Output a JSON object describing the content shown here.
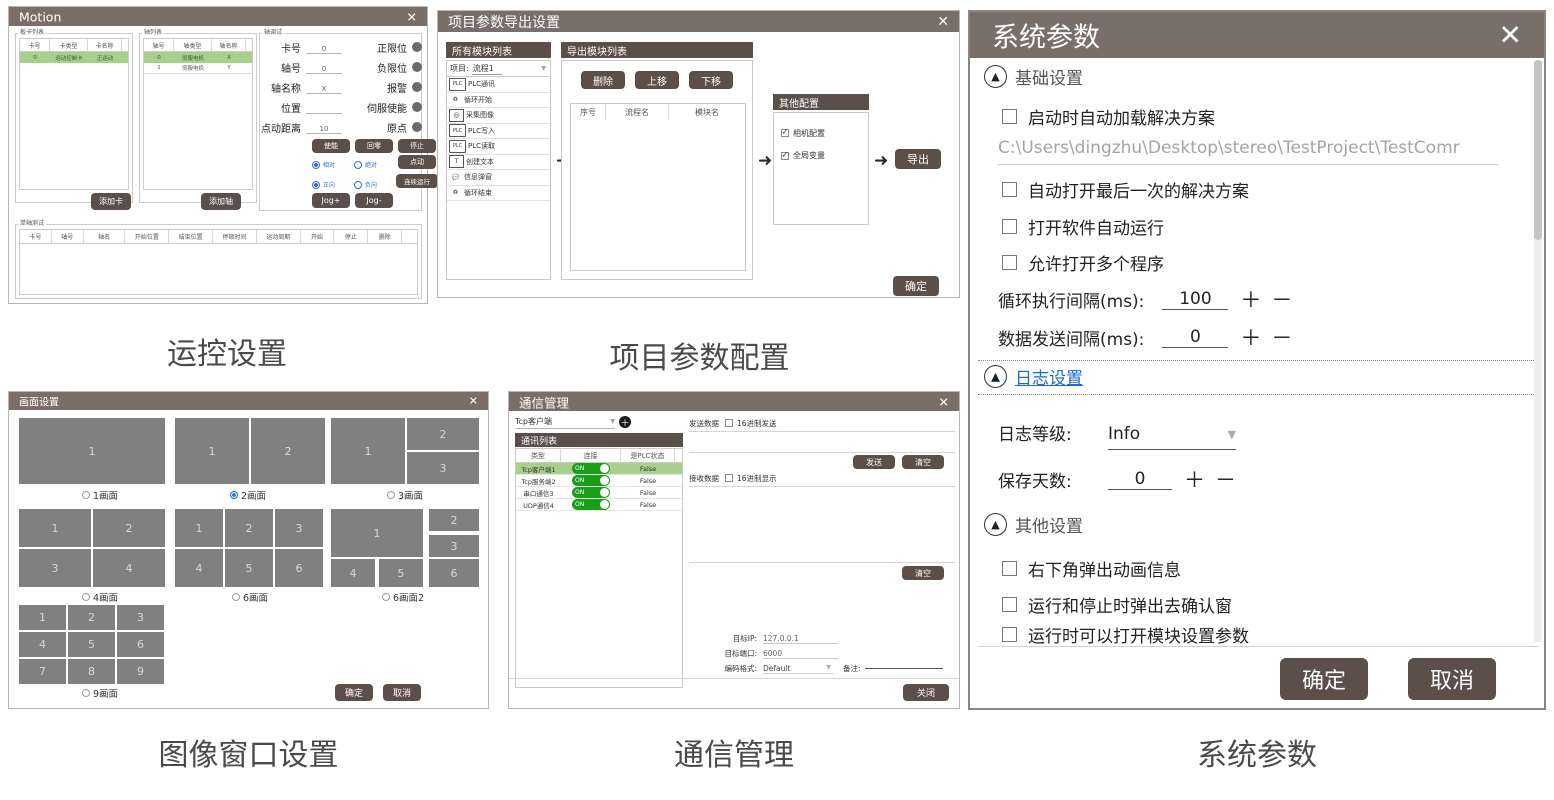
{
  "motion": {
    "title": "Motion",
    "close": "✕",
    "card_group_label": "板卡列表",
    "card_columns": [
      "卡号",
      "卡类型",
      "卡名称"
    ],
    "card_rows": [
      [
        "0",
        "运动控制卡",
        "正运动"
      ]
    ],
    "axis_group_label": "轴列表",
    "axis_columns": [
      "轴号",
      "轴类型",
      "轴名称"
    ],
    "axis_rows": [
      [
        "0",
        "伺服电机",
        "X"
      ],
      [
        "1",
        "伺服电机",
        "Y"
      ]
    ],
    "add_card_button": "添加卡",
    "add_axis_button": "添加轴",
    "debug_group_label": "轴调试",
    "fields": [
      {
        "label": "卡号",
        "value": "0"
      },
      {
        "label": "轴号",
        "value": "0"
      },
      {
        "label": "轴名称",
        "value": "X"
      },
      {
        "label": "位置",
        "value": ""
      },
      {
        "label": "点动距离",
        "value": "10"
      }
    ],
    "status": [
      {
        "label": "正限位"
      },
      {
        "label": "负限位"
      },
      {
        "label": "报警"
      },
      {
        "label": "伺服使能"
      },
      {
        "label": "原点"
      }
    ],
    "buttons": {
      "enable": "使能",
      "home": "回零",
      "stop": "停止",
      "jog_once": "点动",
      "continuous": "连续运行",
      "jog_plus": "Jog+",
      "jog_minus": "Jog-"
    },
    "radios": {
      "relative": "相对",
      "absolute": "绝对",
      "forward": "正向",
      "reverse": "负向"
    },
    "test_group_label": "单轴测试",
    "test_columns": [
      "卡号",
      "轴号",
      "轴名",
      "开始位置",
      "结束位置",
      "停顿时间",
      "运动周期",
      "开始",
      "停止",
      "删除"
    ],
    "caption": "运控设置"
  },
  "export": {
    "title": "项目参数导出设置",
    "close": "✕",
    "all_modules_header": "所有模块列表",
    "project_label": "项目:",
    "project_value": "流程1",
    "modules": [
      {
        "icon": "plc-icon",
        "label": "PLC通讯"
      },
      {
        "icon": "loop-start-icon",
        "label": "循环开始"
      },
      {
        "icon": "camera-icon",
        "label": "采集图像"
      },
      {
        "icon": "plc-icon",
        "label": "PLC写入"
      },
      {
        "icon": "plc-icon",
        "label": "PLC读取"
      },
      {
        "icon": "text-icon",
        "label": "创建文本"
      },
      {
        "icon": "message-icon",
        "label": "信息弹窗"
      },
      {
        "icon": "loop-end-icon",
        "label": "循环结束"
      }
    ],
    "export_modules_header": "导出模块列表",
    "buttons": {
      "delete": "删除",
      "up": "上移",
      "down": "下移",
      "export": "导出",
      "ok": "确定"
    },
    "export_columns": [
      "序号",
      "流程名",
      "模块名"
    ],
    "other_config_header": "其他配置",
    "other_config_items": [
      {
        "label": "相机配置",
        "checked": true
      },
      {
        "label": "全局变量",
        "checked": true
      }
    ],
    "caption": "项目参数配置"
  },
  "screen": {
    "title": "画面设置",
    "close": "✕",
    "layouts": [
      {
        "name": "1画面",
        "selected": false
      },
      {
        "name": "2画面",
        "selected": true
      },
      {
        "name": "3画面",
        "selected": false
      },
      {
        "name": "4画面",
        "selected": false
      },
      {
        "name": "6画面",
        "selected": false
      },
      {
        "name": "6画面2",
        "selected": false
      },
      {
        "name": "9画面",
        "selected": false
      }
    ],
    "ok_button": "确定",
    "cancel_button": "取消",
    "caption": "图像窗口设置"
  },
  "comm": {
    "title": "通信管理",
    "close": "✕",
    "type_select_value": "Tcp客户端",
    "add_icon": "add-icon",
    "list_header": "通讯列表",
    "columns": [
      "类型",
      "连接",
      "是PLC状态"
    ],
    "rows": [
      {
        "type": "Tcp客户端1",
        "toggle": "ON",
        "plc": "False",
        "selected": true
      },
      {
        "type": "Tcp服务端2",
        "toggle": "ON",
        "plc": "False",
        "selected": false
      },
      {
        "type": "串口通信3",
        "toggle": "ON",
        "plc": "False",
        "selected": false
      },
      {
        "type": "UDP通信4",
        "toggle": "ON",
        "plc": "False",
        "selected": false
      }
    ],
    "send_label": "发送数据",
    "send_hex_label": "16进制发送",
    "send_button": "发送",
    "clear_button_1": "清空",
    "recv_label": "接收数据",
    "recv_hex_label": "16进制显示",
    "clear_button_2": "清空",
    "target_ip_label": "目标IP:",
    "target_ip_value": "127.0.0.1",
    "target_port_label": "目标端口:",
    "target_port_value": "6000",
    "encoding_label": "编码格式:",
    "encoding_value": "Default",
    "note_label": "备注:",
    "note_value": "",
    "close_button": "关闭",
    "caption": "通信管理"
  },
  "sysparam": {
    "title": "系统参数",
    "close": "✕",
    "sections": {
      "basic": "基础设置",
      "log": "日志设置",
      "other": "其他设置"
    },
    "basic_items": [
      {
        "label": "启动时自动加载解决方案",
        "checked": false
      }
    ],
    "path_value": "C:\\Users\\dingzhu\\Desktop\\stereo\\TestProject\\TestComr",
    "basic_items2": [
      {
        "label": "自动打开最后一次的解决方案",
        "checked": false
      },
      {
        "label": "打开软件自动运行",
        "checked": false
      },
      {
        "label": "允许打开多个程序",
        "checked": false
      }
    ],
    "loop_interval_label": "循环执行间隔(ms):",
    "loop_interval_value": "100",
    "send_interval_label": "数据发送间隔(ms):",
    "send_interval_value": "0",
    "log_level_label": "日志等级:",
    "log_level_value": "Info",
    "save_days_label": "保存天数:",
    "save_days_value": "0",
    "other_items": [
      {
        "label": "右下角弹出动画信息",
        "checked": false
      },
      {
        "label": "运行和停止时弹出去确认窗",
        "checked": false
      },
      {
        "label": "运行时可以打开模块设置参数",
        "checked": false
      }
    ],
    "plus": "＋",
    "minus": "－",
    "ok_button": "确定",
    "cancel_button": "取消",
    "caption": "系统参数"
  }
}
